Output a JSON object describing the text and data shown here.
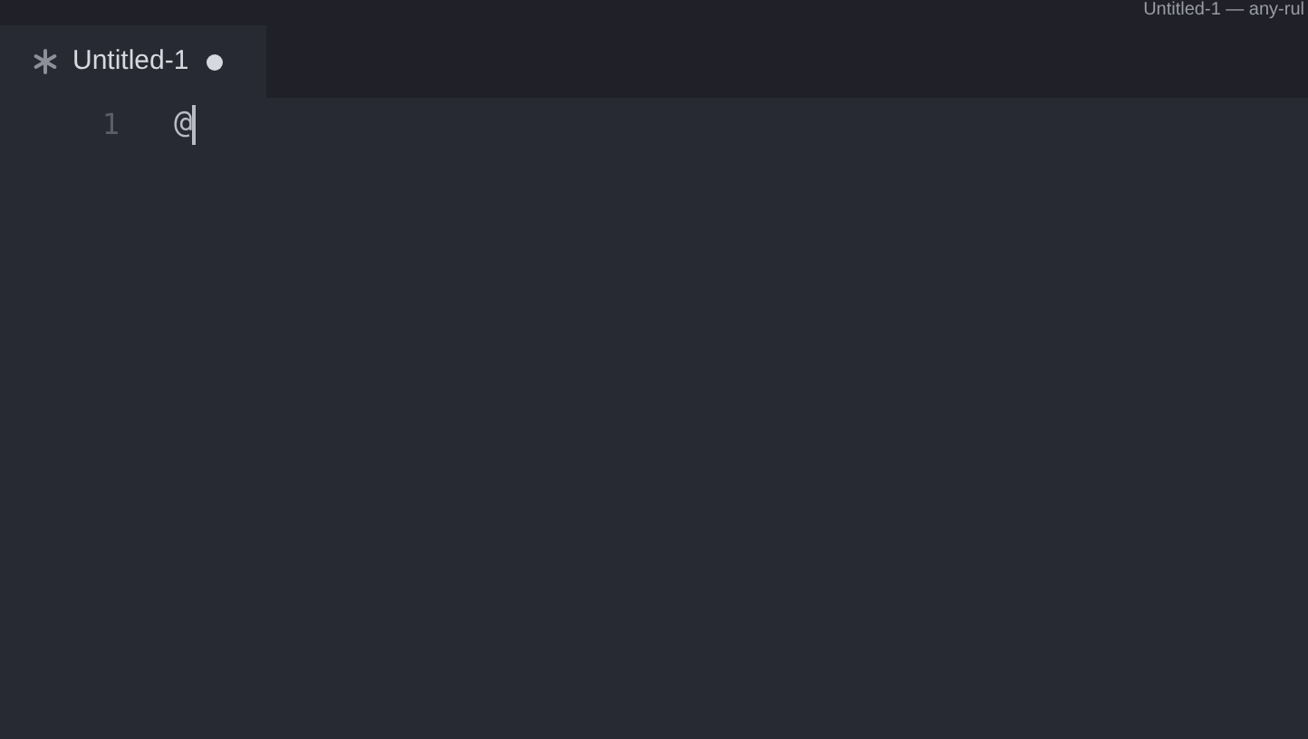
{
  "window": {
    "title": "Untitled-1 — any-rul"
  },
  "tabs": [
    {
      "label": "Untitled-1",
      "selected": true,
      "modified": true
    }
  ],
  "editor": {
    "lines": [
      {
        "number": "1",
        "text": "@",
        "cursor": true
      }
    ]
  }
}
